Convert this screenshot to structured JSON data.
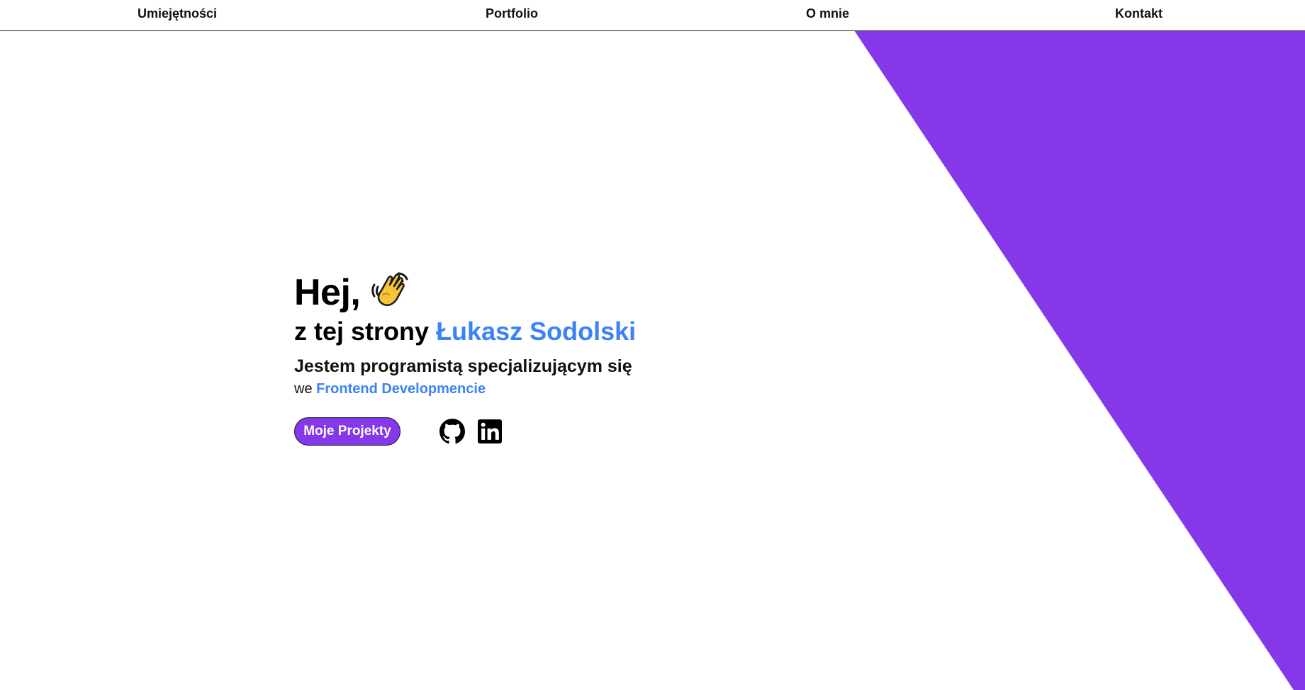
{
  "nav": {
    "items": [
      {
        "label": "Umiejętności"
      },
      {
        "label": "Portfolio"
      },
      {
        "label": "O mnie"
      },
      {
        "label": "Kontakt"
      }
    ]
  },
  "hero": {
    "greeting": "Hej,",
    "greeting_icon": "waving-hand-icon",
    "name_prefix": "z tej strony",
    "name": "Łukasz Sodolski",
    "role_line": "Jestem programistą specjalizującym się",
    "role_prefix": "we",
    "role_specialty": "Frontend Developmencie",
    "projects_button": "Moje Projekty",
    "social_icons": [
      "github-icon",
      "linkedin-icon"
    ]
  },
  "colors": {
    "accent_purple": "#8438ea",
    "accent_blue": "#3b82f6",
    "text": "#111111",
    "background": "#ffffff"
  }
}
